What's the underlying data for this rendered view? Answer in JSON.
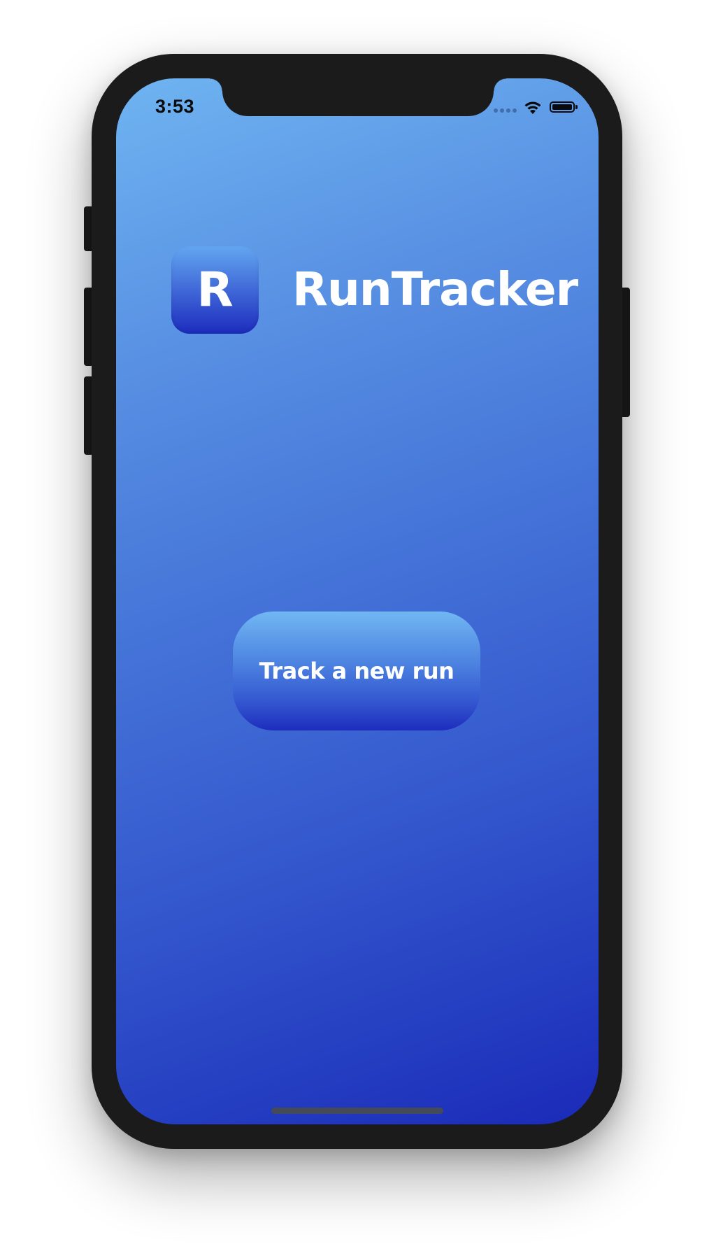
{
  "status_bar": {
    "time": "3:53",
    "signal_icon": "signal-dots-icon",
    "wifi_icon": "wifi-icon",
    "battery_icon": "battery-icon",
    "battery_level": 1.0
  },
  "app": {
    "logo_letter": "R",
    "title": "RunTracker"
  },
  "main": {
    "primary_button_label": "Track a new run"
  },
  "colors": {
    "gradient_top": "#6fb4f1",
    "gradient_bottom": "#1b2ab8",
    "frame": "#1b1b1b",
    "text": "#ffffff"
  }
}
